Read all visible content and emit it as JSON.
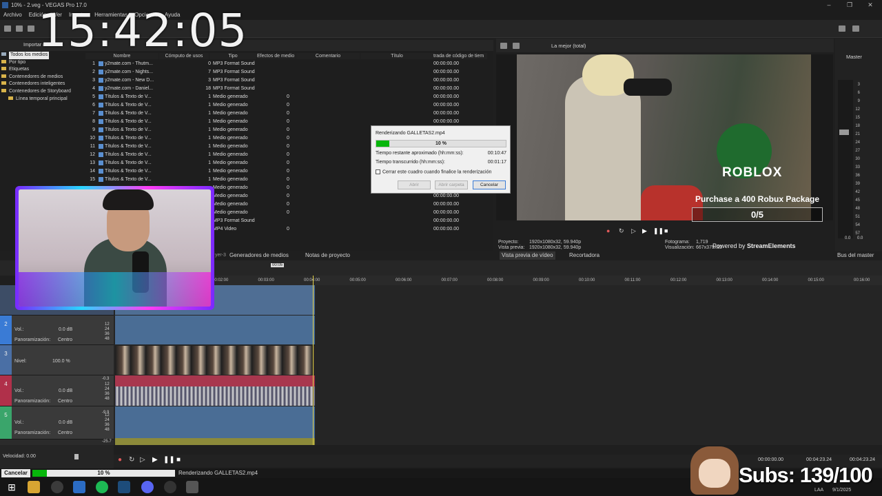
{
  "window": {
    "title": "10% - 2.veg - VEGAS Pro 17.0"
  },
  "menu": [
    "Archivo",
    "Edición",
    "Ver",
    "Insertar",
    "Herramientas",
    "Opciones",
    "Ayuda"
  ],
  "clock": "15:42:05",
  "media_tree": {
    "items": [
      "Todos los medios",
      "Por tipo",
      "Etiquetas",
      "Contenedores de medios",
      "Contenedores inteligentes",
      "Contenedores de Storyboard",
      "Línea temporal principal"
    ],
    "selected": "Todos los medios",
    "tab_label": "Importar medios"
  },
  "media_columns": [
    "Nombre",
    "Cómputo de usos",
    "Tipo",
    "Efectos de medio",
    "Comentario",
    "Título",
    "trada de código de tiem"
  ],
  "media_rows": [
    {
      "n": "1",
      "name": "y2mate.com - Thutm...",
      "uses": "0",
      "type": "MP3 Format Sound",
      "fx": "",
      "tc": "00:00:00.00"
    },
    {
      "n": "2",
      "name": "y2mate.com - Nights...",
      "uses": "7",
      "type": "MP3 Format Sound",
      "fx": "",
      "tc": "00:00:00.00"
    },
    {
      "n": "3",
      "name": "y2mate.com - New D...",
      "uses": "3",
      "type": "MP3 Format Sound",
      "fx": "",
      "tc": "00:00:00.00"
    },
    {
      "n": "4",
      "name": "y2mate.com - Daniel...",
      "uses": "18",
      "type": "MP3 Format Sound",
      "fx": "",
      "tc": "00:00:00.00"
    },
    {
      "n": "5",
      "name": "Títulos & Texto de V...",
      "uses": "1",
      "type": "Medio generado",
      "fx": "0",
      "tc": "00:00:00.00"
    },
    {
      "n": "6",
      "name": "Títulos & Texto de V...",
      "uses": "1",
      "type": "Medio generado",
      "fx": "0",
      "tc": "00:00:00.00"
    },
    {
      "n": "7",
      "name": "Títulos & Texto de V...",
      "uses": "1",
      "type": "Medio generado",
      "fx": "0",
      "tc": "00:00:00.00"
    },
    {
      "n": "8",
      "name": "Títulos & Texto de V...",
      "uses": "1",
      "type": "Medio generado",
      "fx": "0",
      "tc": "00:00:00.00"
    },
    {
      "n": "9",
      "name": "Títulos & Texto de V...",
      "uses": "1",
      "type": "Medio generado",
      "fx": "0",
      "tc": "00:00:00.00"
    },
    {
      "n": "10",
      "name": "Títulos & Texto de V...",
      "uses": "1",
      "type": "Medio generado",
      "fx": "0",
      "tc": "00:00:00.00"
    },
    {
      "n": "11",
      "name": "Títulos & Texto de V...",
      "uses": "1",
      "type": "Medio generado",
      "fx": "0",
      "tc": "00:00:00.00"
    },
    {
      "n": "12",
      "name": "Títulos & Texto de V...",
      "uses": "1",
      "type": "Medio generado",
      "fx": "0",
      "tc": "00:00:00.00"
    },
    {
      "n": "13",
      "name": "Títulos & Texto de V...",
      "uses": "1",
      "type": "Medio generado",
      "fx": "0",
      "tc": "00:00:00.00"
    },
    {
      "n": "14",
      "name": "Títulos & Texto de V...",
      "uses": "1",
      "type": "Medio generado",
      "fx": "0",
      "tc": "00:00:00.00"
    },
    {
      "n": "15",
      "name": "Títulos & Texto de V...",
      "uses": "1",
      "type": "Medio generado",
      "fx": "0",
      "tc": "00:00:00.00"
    },
    {
      "n": "",
      "name": "",
      "uses": "",
      "type": "Medio generado",
      "fx": "0",
      "tc": "00:00:00.00"
    },
    {
      "n": "",
      "name": "",
      "uses": "",
      "type": "Medio generado",
      "fx": "0",
      "tc": "00:00:00.00"
    },
    {
      "n": "",
      "name": "",
      "uses": "",
      "type": "Medio generado",
      "fx": "0",
      "tc": "00:00:00.00"
    },
    {
      "n": "",
      "name": "",
      "uses": "",
      "type": "Medio generado",
      "fx": "0",
      "tc": "00:00:00.00"
    },
    {
      "n": "",
      "name": "",
      "uses": "",
      "type": "MP3 Format Sound",
      "fx": "",
      "tc": "00:00:00.00"
    },
    {
      "n": "",
      "name": "",
      "uses": "",
      "type": "MP4 Video",
      "fx": "0",
      "tc": "00:00:00.00"
    }
  ],
  "render_dialog": {
    "title": "Renderizando GALLETAS2.mp4",
    "progress_label": "10 %",
    "progress": 0.1,
    "remaining_label": "Tiempo restante aproximado (hh:mm:ss):",
    "remaining_value": "00:10:47",
    "elapsed_label": "Tiempo transcurrido (hh:mm:ss):",
    "elapsed_value": "00:01:17",
    "close_checkbox": "Cerrar este cuadro cuando finalice la renderización",
    "btn_open": "Abrir",
    "btn_open_folder": "Abrir carpeta",
    "btn_cancel": "Cancelar"
  },
  "preview": {
    "quality": "La mejor (total)",
    "project_label": "Proyecto:",
    "project_value": "1920x1080x32, 59.940p",
    "preview_label": "Vista previa:",
    "preview_value": "1920x1080x32, 59.940p",
    "frame_label": "Fotograma:",
    "frame_value": "1,719",
    "display_label": "Visualización:",
    "display_value": "667x375x32",
    "tab1": "Vista previa de vídeo",
    "tab2": "Recortadora",
    "overlay_logo": "ROBLOX",
    "overlay_text": "Purchase a 400 Robux Package",
    "overlay_count": "0/5",
    "powered_prefix": "Powered by ",
    "powered_brand": "StreamElements"
  },
  "master": {
    "label": "Master",
    "bus_tab": "Bus del master",
    "db_marks": [
      "3",
      "6",
      "9",
      "12",
      "15",
      "18",
      "21",
      "24",
      "27",
      "30",
      "33",
      "36",
      "39",
      "42",
      "45",
      "48",
      "51",
      "54",
      "57"
    ],
    "bottom_l": "0.0",
    "bottom_r": "0.0"
  },
  "tabs": {
    "generators": "Generadores de medios",
    "notes": "Notas de proyecto",
    "layer": "yer-3"
  },
  "ruler": {
    "marker": "00:05",
    "labels": [
      "00:02:00",
      "00:03:00",
      "00:04:00",
      "00:05:00",
      "00:06:00",
      "00:07:00",
      "00:08:00",
      "00:09:00",
      "00:10:00",
      "00:11:00",
      "00:12:00",
      "00:13:00",
      "00:14:00",
      "00:15:00",
      "00:16:00"
    ]
  },
  "tracks": [
    {
      "num": "",
      "kind": "video"
    },
    {
      "num": "2",
      "vol_label": "Vol.:",
      "vol": "0.0 dB",
      "pan_label": "Panoramización:",
      "pan": "Centro"
    },
    {
      "num": "3",
      "level_label": "Nivel:",
      "level": "100.0 %"
    },
    {
      "num": "4",
      "vol_label": "Vol.:",
      "vol": "0.0 dB",
      "pan_label": "Panoramización:",
      "pan": "Centro",
      "peak": "-0.3"
    },
    {
      "num": "5",
      "vol_label": "Vol.:",
      "vol": "0.0 dB",
      "pan_label": "Panoramización:",
      "pan": "Centro",
      "peak": "-9.9"
    }
  ],
  "meter_scale": [
    "12",
    "24",
    "36",
    "48"
  ],
  "last_peak": "-25.7",
  "velocity": "Velocidad: 0.00",
  "timecodes": {
    "start": "00:00:00.00",
    "end": "00:04:23.24",
    "length": "00:04:23.24"
  },
  "status": {
    "cancel": "Cancelar",
    "progress_label": "10 %",
    "progress": 0.1,
    "message": "Renderizando GALLETAS2.mp4"
  },
  "subs": "Subs: 139/100",
  "taskbar": {
    "lang": "LAA",
    "date": "9/1/2025"
  },
  "colors": {
    "progress_green": "#07b60b",
    "accent_blue": "#3a7bd5",
    "audio_clip": "#4a6d95",
    "video_clip": "#5a7aa8"
  }
}
